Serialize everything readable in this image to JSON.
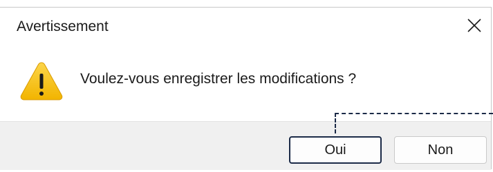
{
  "dialog": {
    "title": "Avertissement",
    "message": "Voulez-vous enregistrer les modifications ?",
    "icon": "warning-icon",
    "close_icon": "close-icon"
  },
  "buttons": {
    "yes_label": "Oui",
    "no_label": "Non"
  },
  "colors": {
    "accent_border": "#1b2a47",
    "warning_yellow": "#f7c21b",
    "footer_bg": "#f0f0f0"
  }
}
